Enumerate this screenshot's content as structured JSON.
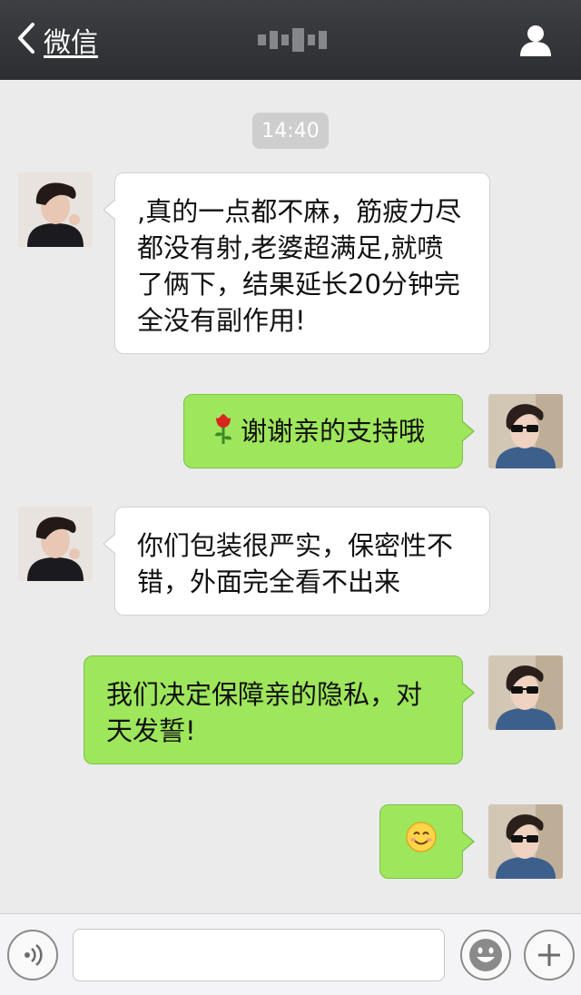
{
  "navbar": {
    "back_label": "微信",
    "icons": {
      "back": "chevron-left-icon",
      "profile": "person-icon"
    }
  },
  "chat": {
    "timestamp": "14:40",
    "messages": [
      {
        "side": "left",
        "text": ",真的一点都不麻，筋疲力尽都没有射,老婆超满足,就喷了俩下，结果延长20分钟完全没有副作用!"
      },
      {
        "side": "right",
        "icon": "rose-icon",
        "text": "谢谢亲的支持哦"
      },
      {
        "side": "left",
        "text": "你们包装很严实，保密性不错，外面完全看不出来"
      },
      {
        "side": "right",
        "text": "我们决定保障亲的隐私，对天发誓!"
      },
      {
        "side": "right",
        "icon": "smiley-emoji-icon",
        "text": ""
      }
    ]
  },
  "inputbar": {
    "icons": {
      "voice": "voice-icon",
      "emoji": "emoji-icon",
      "more": "plus-icon"
    },
    "input_value": ""
  },
  "colors": {
    "navbar": "#2c2e31",
    "background": "#ebebeb",
    "bubble_sent": "#9ee65b",
    "bubble_received": "#ffffff"
  }
}
